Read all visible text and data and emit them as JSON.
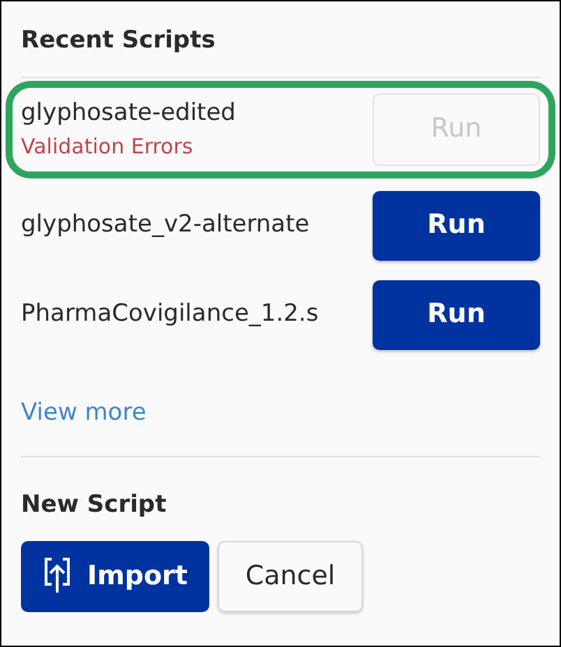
{
  "title": "Recent Scripts",
  "scripts": [
    {
      "name": "glyphosate-edited",
      "error": "Validation Errors",
      "highlighted": true,
      "run": {
        "label": "Run",
        "disabled": true
      }
    },
    {
      "name": "glyphosate_v2-alternate",
      "highlighted": false,
      "run": {
        "label": "Run",
        "disabled": false
      }
    },
    {
      "name": "PharmaCovigilance_1.2.s",
      "highlighted": false,
      "run": {
        "label": "Run",
        "disabled": false
      }
    }
  ],
  "view_more": "View more",
  "new_script": {
    "title": "New Script",
    "import": "Import",
    "cancel": "Cancel"
  }
}
